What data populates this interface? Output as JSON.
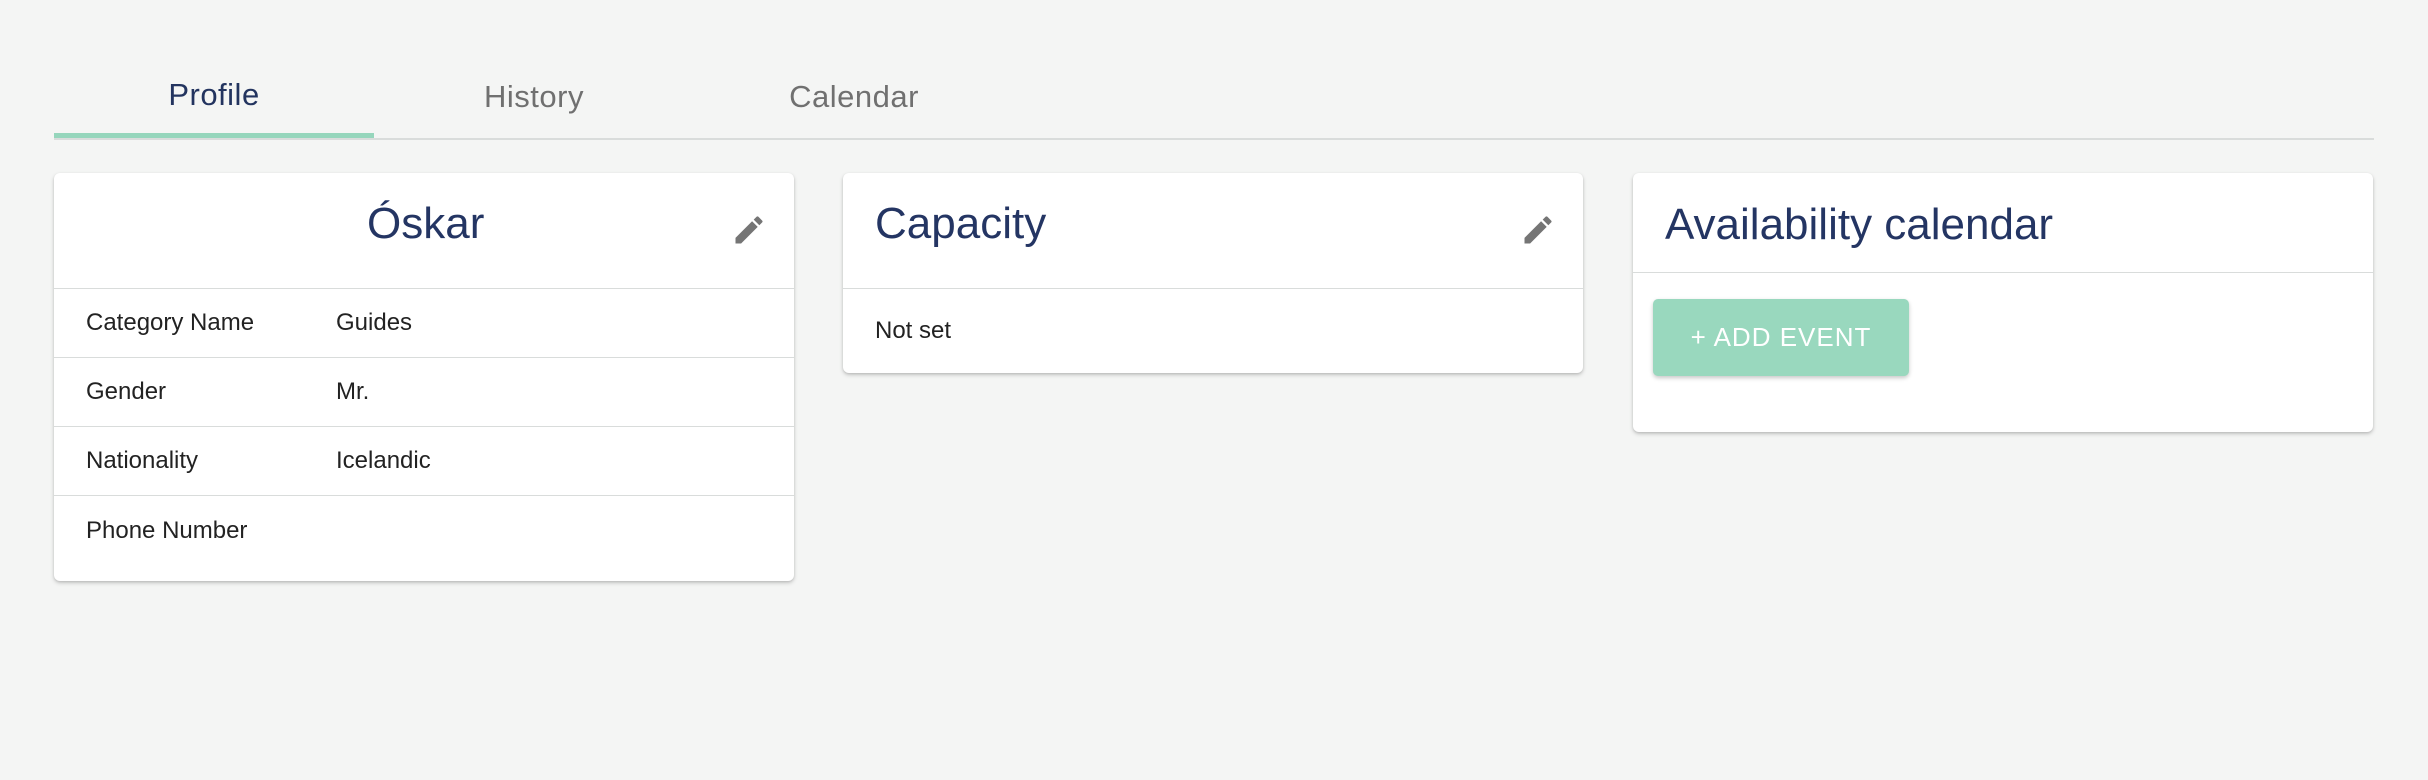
{
  "tabs": [
    {
      "label": "Profile",
      "active": true
    },
    {
      "label": "History",
      "active": false
    },
    {
      "label": "Calendar",
      "active": false
    }
  ],
  "profile_card": {
    "title": "Óskar",
    "edit_icon": "pencil-icon",
    "rows": [
      {
        "label": "Category Name",
        "value": "Guides"
      },
      {
        "label": "Gender",
        "value": "Mr."
      },
      {
        "label": "Nationality",
        "value": "Icelandic"
      },
      {
        "label": "Phone Number",
        "value": ""
      }
    ]
  },
  "capacity_card": {
    "title": "Capacity",
    "edit_icon": "pencil-icon",
    "value": "Not set"
  },
  "availability_card": {
    "title": "Availability calendar",
    "add_event_label": "+ ADD EVENT"
  },
  "colors": {
    "accent": "#96d6bc",
    "title": "#243563",
    "background": "#f4f5f4"
  }
}
